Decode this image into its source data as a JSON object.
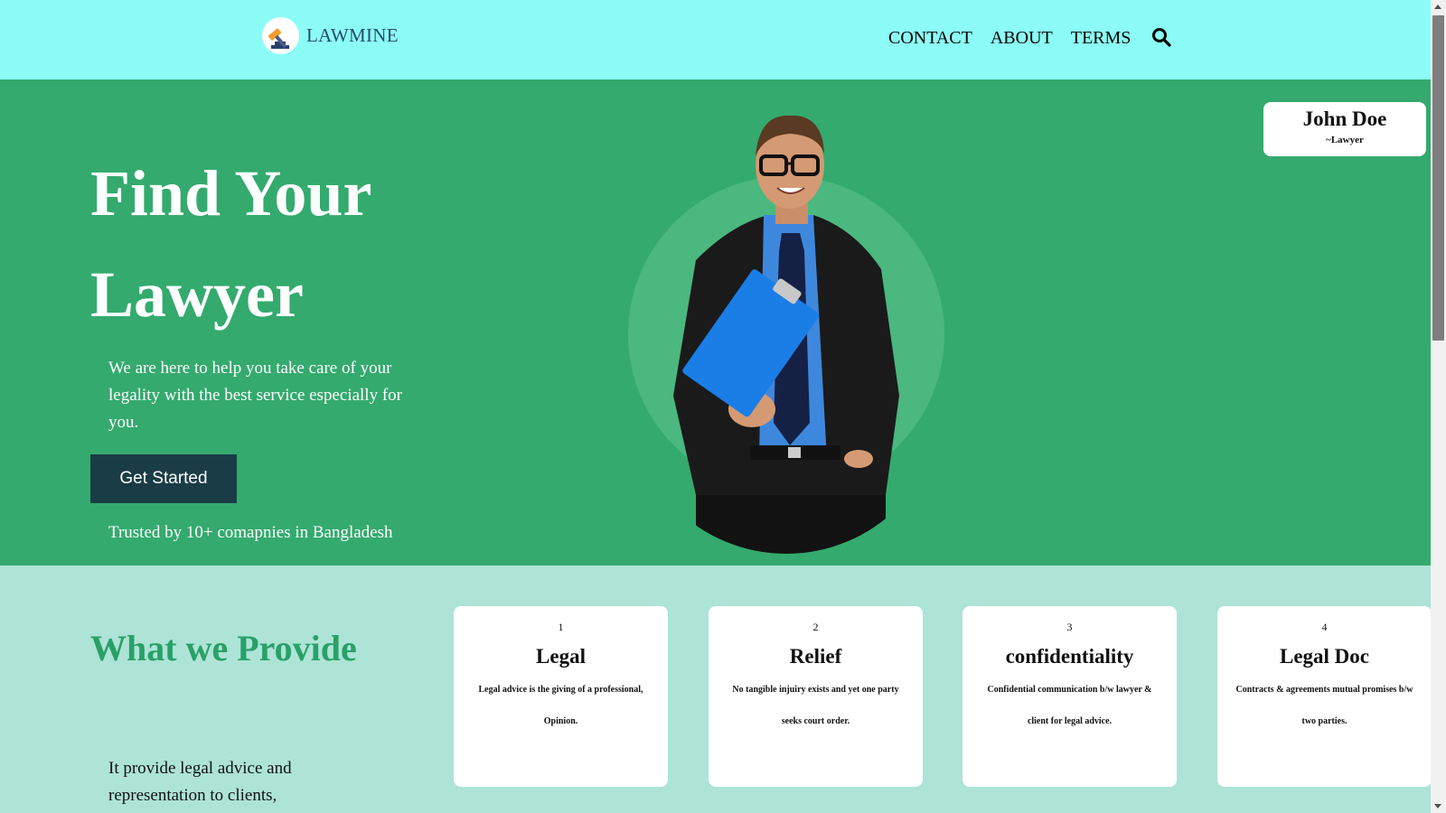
{
  "brand": {
    "name": "LAWMINE",
    "logo_icon": "gavel-icon"
  },
  "nav": {
    "links": [
      "CONTACT",
      "ABOUT",
      "TERMS"
    ],
    "search_icon": "search-icon"
  },
  "hero": {
    "title": "Find Your Lawyer",
    "subtitle": "We are here to help you take care of your legality with the best service especially for you.",
    "cta_label": "Get Started",
    "trusted": "Trusted by 10+ comapnies in Bangladesh",
    "profile": {
      "name": "John Doe",
      "role": "~Lawyer"
    }
  },
  "provide": {
    "title": "What we Provide",
    "text": "It provide legal advice and representation to clients,",
    "cards": [
      {
        "num": "1",
        "title": "Legal",
        "desc": "Legal advice is the giving of a professional, Opinion."
      },
      {
        "num": "2",
        "title": "Relief",
        "desc": "No tangible injuiry exists and yet one party seeks court order."
      },
      {
        "num": "3",
        "title": "confidentiality",
        "desc": "Confidential communication b/w lawyer & client for legal advice."
      },
      {
        "num": "4",
        "title": "Legal Doc",
        "desc": "Contracts & agreements mutual promises b/w two parties."
      }
    ]
  },
  "colors": {
    "navbar": "#8bfdf6",
    "hero": "#34aa6e",
    "section": "#ade4d6",
    "cta": "#1a3d45",
    "heading_green": "#2aa069"
  }
}
